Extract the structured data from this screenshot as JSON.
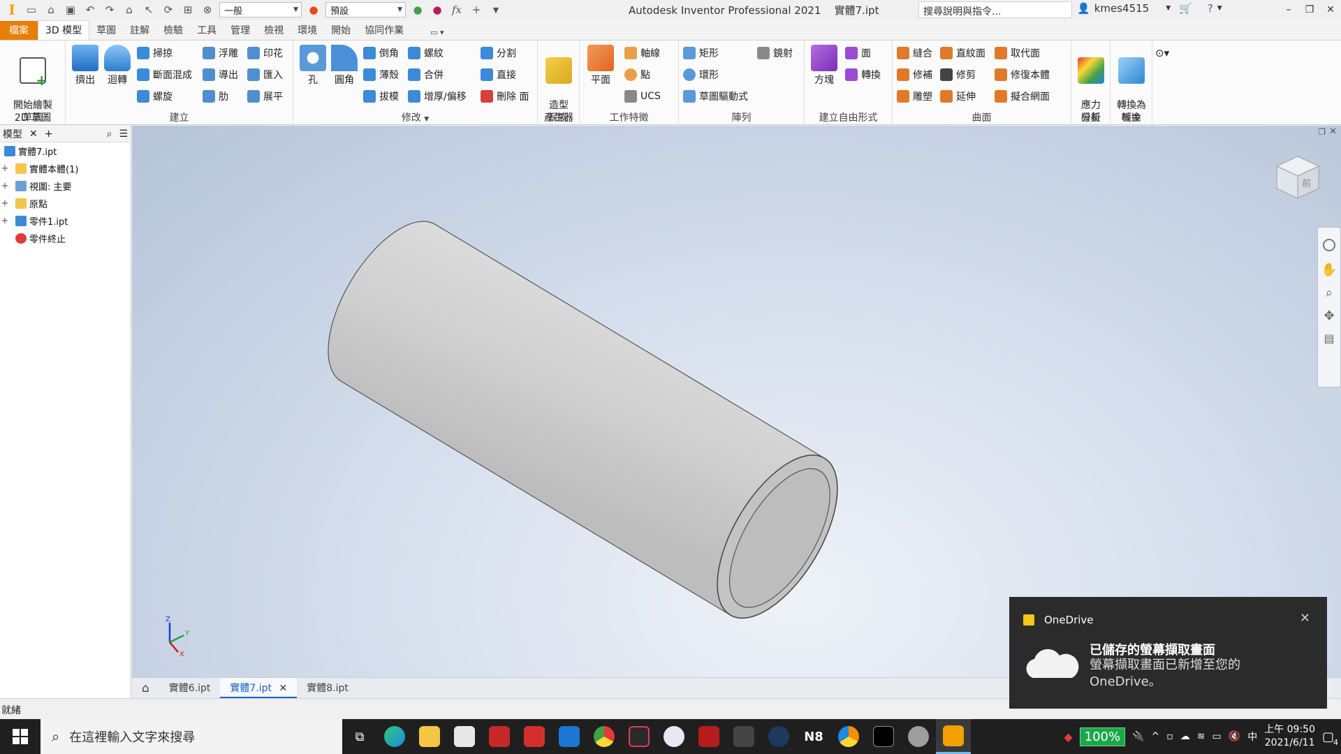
{
  "titlebar": {
    "app_title": "Autodesk Inventor Professional 2021",
    "doc_name": "實體7.ipt",
    "appearance_combo": "一般",
    "material_combo": "預設",
    "search_placeholder": "搜尋說明與指令...",
    "user": "kmes4515"
  },
  "ribbon_tabs": [
    "檔案",
    "3D 模型",
    "草圖",
    "註解",
    "檢驗",
    "工具",
    "管理",
    "檢視",
    "環境",
    "開始",
    "協同作業"
  ],
  "ribbon": {
    "sketch": {
      "label": "草圖",
      "start_sketch": "開始繪製\n2D 草圖"
    },
    "create": {
      "label": "建立",
      "extrude": "擠出",
      "revolve": "迴轉",
      "sweep": "掃掠",
      "loft": "斷面混成",
      "coil": "螺旋",
      "emboss": "浮雕",
      "derive": "導出",
      "rib": "肋",
      "decal": "印花",
      "import": "匯入",
      "unfold": "展平"
    },
    "modify": {
      "label": "修改",
      "hole": "孔",
      "fillet": "圓角",
      "chamfer": "倒角",
      "shell": "薄殼",
      "draft": "拔模",
      "thread": "螺紋",
      "combine": "合併",
      "thicken": "增厚/偏移",
      "split": "分割",
      "direct": "直接",
      "delete_face": "刪除 面"
    },
    "explore": {
      "label": "探索",
      "shape_generator": "造型\n產生器"
    },
    "work_features": {
      "label": "工作特徵",
      "plane": "平面",
      "axis": "軸線",
      "point": "點",
      "ucs": "UCS"
    },
    "pattern": {
      "label": "陣列",
      "rectangular": "矩形",
      "circular": "環形",
      "sketch_driven": "草圖驅動式",
      "mirror": "鏡射"
    },
    "freeform": {
      "label": "建立自由形式",
      "box": "方塊",
      "face": "面",
      "convert": "轉換"
    },
    "surface": {
      "label": "曲面",
      "stitch": "縫合",
      "patch": "修補",
      "sculpt": "雕塑",
      "ruled": "直紋面",
      "trim": "修剪",
      "extend": "延伸",
      "replace": "取代面",
      "repair": "修復本體",
      "fit_mesh": "擬合網面"
    },
    "simulation": {
      "label": "模擬",
      "stress": "應力\n分析"
    },
    "convert": {
      "label": "轉換",
      "sheet_metal": "轉換為\n板金"
    }
  },
  "browser": {
    "tab": "模型",
    "items": [
      {
        "label": "實體7.ipt",
        "expand": ""
      },
      {
        "label": "實體本體(1)",
        "expand": "+"
      },
      {
        "label": "視圖: 主要",
        "expand": "+"
      },
      {
        "label": "原點",
        "expand": "+"
      },
      {
        "label": "零件1.ipt",
        "expand": "+"
      },
      {
        "label": "零件終止",
        "expand": ""
      }
    ]
  },
  "viewcube": {
    "face_label": "前"
  },
  "doc_tabs": [
    "實體6.ipt",
    "實體7.ipt",
    "實體8.ipt"
  ],
  "status": "就緒",
  "toast": {
    "app": "OneDrive",
    "heading": "已儲存的螢幕擷取畫面",
    "body": "螢幕擷取畫面已新增至您的 OneDrive。"
  },
  "taskbar": {
    "search_placeholder": "在這裡輸入文字來搜尋",
    "battery": "100%",
    "ime": "中",
    "time": "上午 09:50",
    "date": "2021/6/11",
    "notifications": "4"
  },
  "colors": {
    "file_tab": "#e87e04",
    "active_doc_tab": "#1a62c8",
    "toast_bg": "#2b2b2b",
    "taskbar_bg": "#1f1f1f",
    "battery": "#1ba84a"
  }
}
